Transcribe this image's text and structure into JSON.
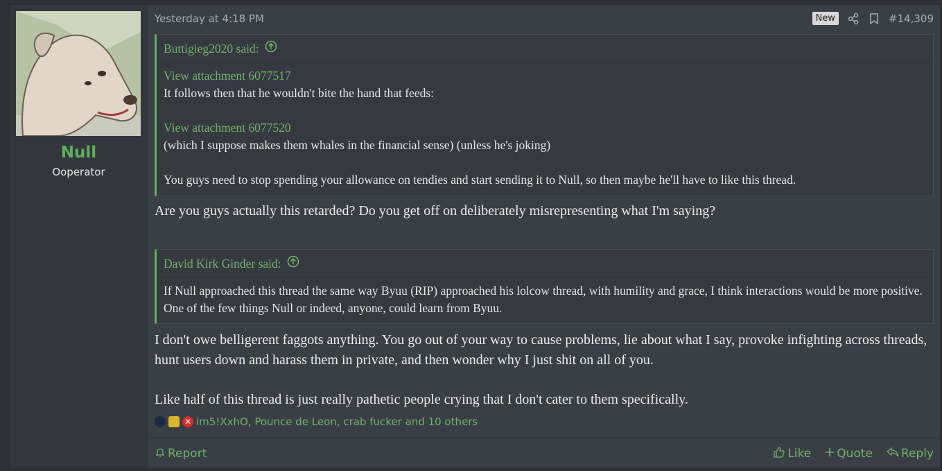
{
  "author": {
    "name": "Null",
    "title": "Ooperator"
  },
  "header": {
    "time": "Yesterday at 4:18 PM",
    "badge": "New",
    "post_number": "#14,309"
  },
  "quote1": {
    "author": "Buttigieg2020 said:",
    "att1": "View attachment 6077517",
    "line1": "It follows then that he wouldn't bite the hand that feeds:",
    "att2": "View attachment 6077520",
    "line2": "(which I suppose makes them whales in the financial sense) (unless he's joking)",
    "line3": "You guys need to stop spending your allowance on tendies and start sending it to Null, so then maybe he'll have to like this thread."
  },
  "reply1": "Are you guys actually this retarded? Do you get off on deliberately misrepresenting what I'm saying?",
  "quote2": {
    "author": "David Kirk Ginder said:",
    "text": "If Null approached this thread the same way Byuu (RIP) approached his lolcow thread, with humility and grace, I think interactions would be more positive. One of the few things Null or indeed, anyone, could learn from Byuu."
  },
  "reply2": "I don't owe belligerent faggots anything. You go out of your way to cause problems, lie about what I say, provoke infighting across threads, hunt users down and harass them in private, and then wonder why I just shit on all of you.",
  "reply3": "Like half of this thread is just really pathetic people crying that I don't cater to them specifically.",
  "reactions": {
    "text": "im5!XxhO, Pounce de Leon, crab fucker and 10 others"
  },
  "footer": {
    "report": "Report",
    "like": "Like",
    "quote": "Quote",
    "reply": "Reply"
  },
  "colors": {
    "accent": "#5db05d",
    "bg": "#3a3e45"
  }
}
